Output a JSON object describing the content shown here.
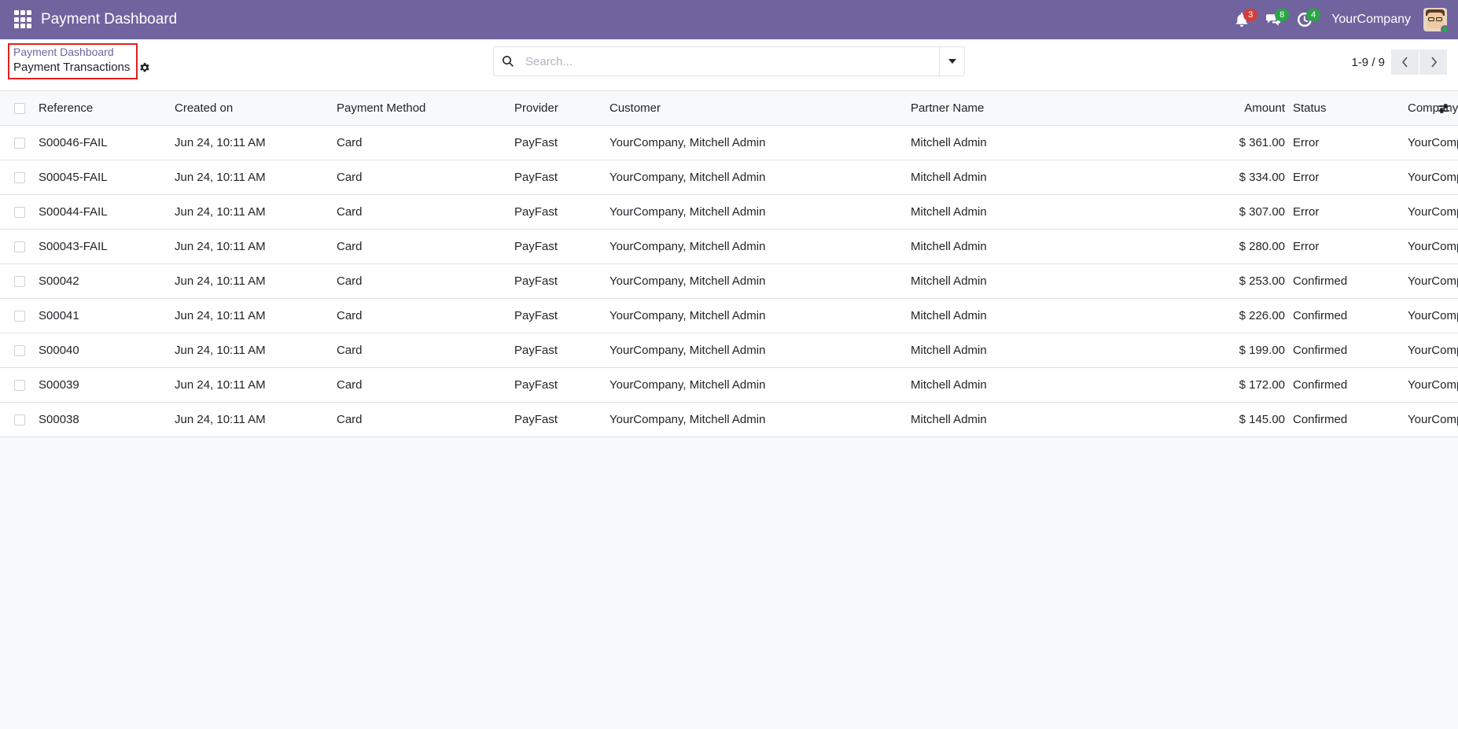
{
  "navbar": {
    "app_title": "Payment Dashboard",
    "activity_badge": "3",
    "messages_badge": "8",
    "clock_badge": "4",
    "company": "YourCompany",
    "colors": {
      "brand": "#71639e",
      "badge_red": "#d23f3a",
      "badge_green": "#28a745"
    }
  },
  "control_panel": {
    "breadcrumb_parent": "Payment Dashboard",
    "breadcrumb_current": "Payment Transactions",
    "search_placeholder": "Search...",
    "pager_value": "1-9 / 9"
  },
  "table": {
    "headers": {
      "reference": "Reference",
      "created_on": "Created on",
      "payment_method": "Payment Method",
      "provider": "Provider",
      "customer": "Customer",
      "partner_name": "Partner Name",
      "amount": "Amount",
      "status": "Status",
      "company": "Company"
    },
    "rows": [
      {
        "reference": "S00046-FAIL",
        "created_on": "Jun 24, 10:11 AM",
        "payment_method": "Card",
        "provider": "PayFast",
        "customer": "YourCompany, Mitchell Admin",
        "partner_name": "Mitchell Admin",
        "amount": "$ 361.00",
        "status": "Error",
        "company": "YourCompany"
      },
      {
        "reference": "S00045-FAIL",
        "created_on": "Jun 24, 10:11 AM",
        "payment_method": "Card",
        "provider": "PayFast",
        "customer": "YourCompany, Mitchell Admin",
        "partner_name": "Mitchell Admin",
        "amount": "$ 334.00",
        "status": "Error",
        "company": "YourCompany"
      },
      {
        "reference": "S00044-FAIL",
        "created_on": "Jun 24, 10:11 AM",
        "payment_method": "Card",
        "provider": "PayFast",
        "customer": "YourCompany, Mitchell Admin",
        "partner_name": "Mitchell Admin",
        "amount": "$ 307.00",
        "status": "Error",
        "company": "YourCompany"
      },
      {
        "reference": "S00043-FAIL",
        "created_on": "Jun 24, 10:11 AM",
        "payment_method": "Card",
        "provider": "PayFast",
        "customer": "YourCompany, Mitchell Admin",
        "partner_name": "Mitchell Admin",
        "amount": "$ 280.00",
        "status": "Error",
        "company": "YourCompany"
      },
      {
        "reference": "S00042",
        "created_on": "Jun 24, 10:11 AM",
        "payment_method": "Card",
        "provider": "PayFast",
        "customer": "YourCompany, Mitchell Admin",
        "partner_name": "Mitchell Admin",
        "amount": "$ 253.00",
        "status": "Confirmed",
        "company": "YourCompany"
      },
      {
        "reference": "S00041",
        "created_on": "Jun 24, 10:11 AM",
        "payment_method": "Card",
        "provider": "PayFast",
        "customer": "YourCompany, Mitchell Admin",
        "partner_name": "Mitchell Admin",
        "amount": "$ 226.00",
        "status": "Confirmed",
        "company": "YourCompany"
      },
      {
        "reference": "S00040",
        "created_on": "Jun 24, 10:11 AM",
        "payment_method": "Card",
        "provider": "PayFast",
        "customer": "YourCompany, Mitchell Admin",
        "partner_name": "Mitchell Admin",
        "amount": "$ 199.00",
        "status": "Confirmed",
        "company": "YourCompany"
      },
      {
        "reference": "S00039",
        "created_on": "Jun 24, 10:11 AM",
        "payment_method": "Card",
        "provider": "PayFast",
        "customer": "YourCompany, Mitchell Admin",
        "partner_name": "Mitchell Admin",
        "amount": "$ 172.00",
        "status": "Confirmed",
        "company": "YourCompany"
      },
      {
        "reference": "S00038",
        "created_on": "Jun 24, 10:11 AM",
        "payment_method": "Card",
        "provider": "PayFast",
        "customer": "YourCompany, Mitchell Admin",
        "partner_name": "Mitchell Admin",
        "amount": "$ 145.00",
        "status": "Confirmed",
        "company": "YourCompany"
      }
    ]
  }
}
